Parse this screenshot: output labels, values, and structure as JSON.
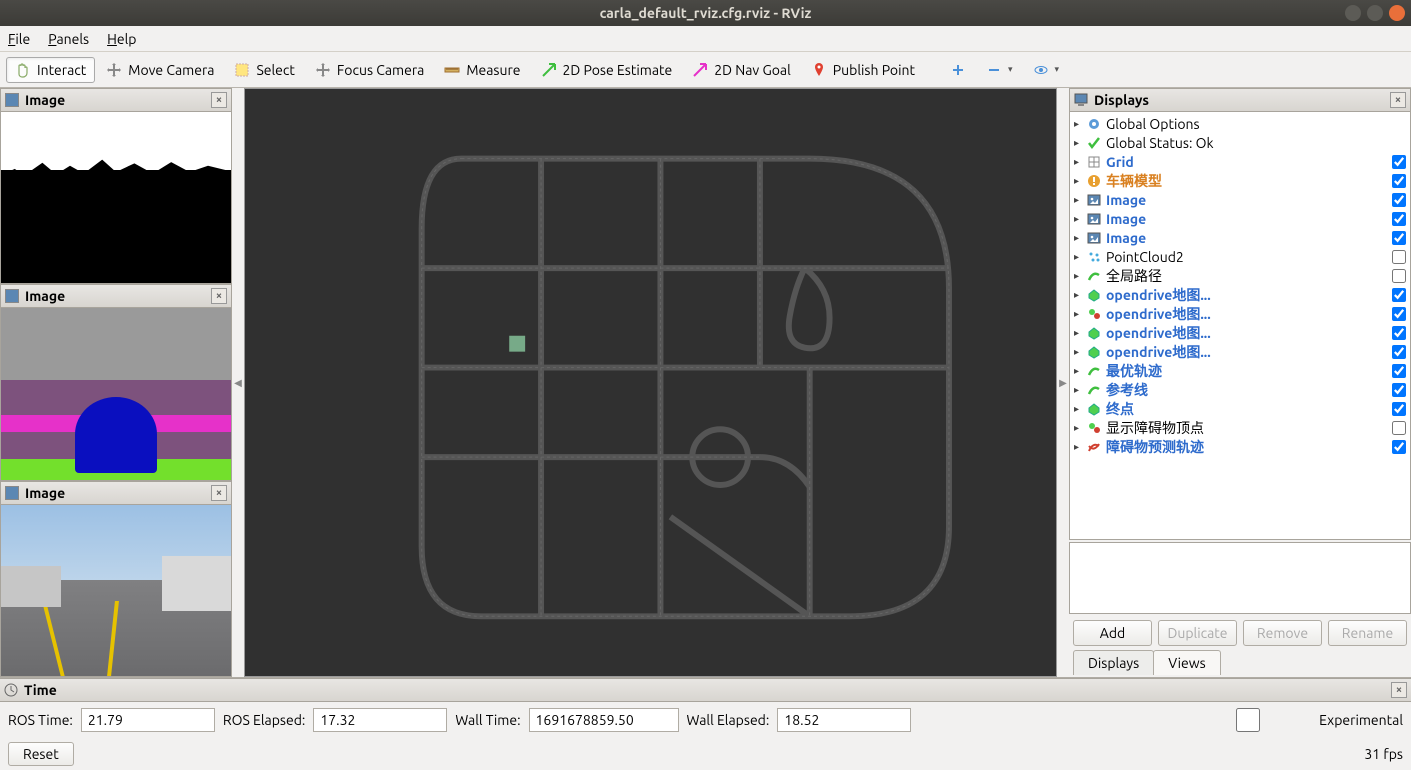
{
  "window": {
    "title": "carla_default_rviz.cfg.rviz - RViz"
  },
  "menu": {
    "file": "File",
    "panels": "Panels",
    "help": "Help"
  },
  "toolbar": {
    "interact": "Interact",
    "move_camera": "Move Camera",
    "select": "Select",
    "focus_camera": "Focus Camera",
    "measure": "Measure",
    "pose_estimate": "2D Pose Estimate",
    "nav_goal": "2D Nav Goal",
    "publish_point": "Publish Point"
  },
  "left_panels": [
    {
      "title": "Image"
    },
    {
      "title": "Image"
    },
    {
      "title": "Image"
    }
  ],
  "displays_panel": {
    "title": "Displays",
    "items": [
      {
        "icon": "gear-blue",
        "label": "Global Options",
        "style": "",
        "checkbox": null
      },
      {
        "icon": "check-green",
        "label": "Global Status: Ok",
        "style": "",
        "checkbox": null
      },
      {
        "icon": "grid",
        "label": "Grid",
        "style": "blue",
        "checkbox": true
      },
      {
        "icon": "warn",
        "label": "车辆模型",
        "style": "orange",
        "checkbox": true
      },
      {
        "icon": "image",
        "label": "Image",
        "style": "blue",
        "checkbox": true
      },
      {
        "icon": "image",
        "label": "Image",
        "style": "blue",
        "checkbox": true
      },
      {
        "icon": "image",
        "label": "Image",
        "style": "blue",
        "checkbox": true
      },
      {
        "icon": "points",
        "label": "PointCloud2",
        "style": "",
        "checkbox": false
      },
      {
        "icon": "path-green",
        "label": "全局路径",
        "style": "",
        "checkbox": false
      },
      {
        "icon": "marker-g",
        "label": "opendrive地图...",
        "style": "blue",
        "checkbox": true
      },
      {
        "icon": "marker-m",
        "label": "opendrive地图...",
        "style": "blue",
        "checkbox": true
      },
      {
        "icon": "marker-g",
        "label": "opendrive地图...",
        "style": "blue",
        "checkbox": true
      },
      {
        "icon": "marker-g",
        "label": "opendrive地图...",
        "style": "blue",
        "checkbox": true
      },
      {
        "icon": "path-green",
        "label": "最优轨迹",
        "style": "blue",
        "checkbox": true
      },
      {
        "icon": "path-green",
        "label": "参考线",
        "style": "blue",
        "checkbox": true
      },
      {
        "icon": "marker-g",
        "label": "终点",
        "style": "blue",
        "checkbox": true
      },
      {
        "icon": "marker-m",
        "label": "显示障碍物顶点",
        "style": "",
        "checkbox": false
      },
      {
        "icon": "path-red",
        "label": "障碍物预测轨迹",
        "style": "blue",
        "checkbox": true
      }
    ],
    "buttons": {
      "add": "Add",
      "duplicate": "Duplicate",
      "remove": "Remove",
      "rename": "Rename"
    },
    "tabs": {
      "displays": "Displays",
      "views": "Views"
    }
  },
  "time_panel": {
    "title": "Time",
    "ros_time_label": "ROS Time:",
    "ros_time": "21.79",
    "ros_elapsed_label": "ROS Elapsed:",
    "ros_elapsed": "17.32",
    "wall_time_label": "Wall Time:",
    "wall_time": "1691678859.50",
    "wall_elapsed_label": "Wall Elapsed:",
    "wall_elapsed": "18.52",
    "experimental": "Experimental"
  },
  "footer": {
    "reset": "Reset",
    "fps": "31 fps"
  }
}
